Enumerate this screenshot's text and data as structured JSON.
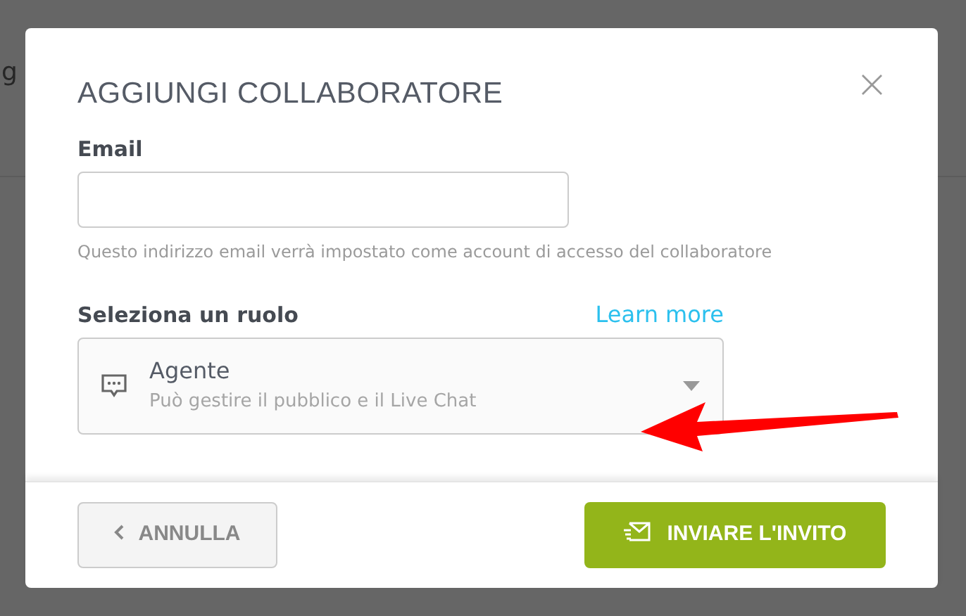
{
  "background": {
    "text_fragment": "g"
  },
  "modal": {
    "title": "AGGIUNGI COLLABORATORE",
    "close": "×",
    "email": {
      "label": "Email",
      "hint": "Questo indirizzo email verrà impostato come account di accesso del collaboratore"
    },
    "role": {
      "label": "Seleziona un ruolo",
      "link": "Learn more",
      "selected_name": "Agente",
      "selected_description": "Può gestire il pubblico e il Live Chat"
    },
    "buttons": [
      {
        "kind": "cancel",
        "label": "ANNULLA"
      },
      {
        "kind": "primary",
        "label": "INVIARE L'INVITO"
      }
    ]
  }
}
